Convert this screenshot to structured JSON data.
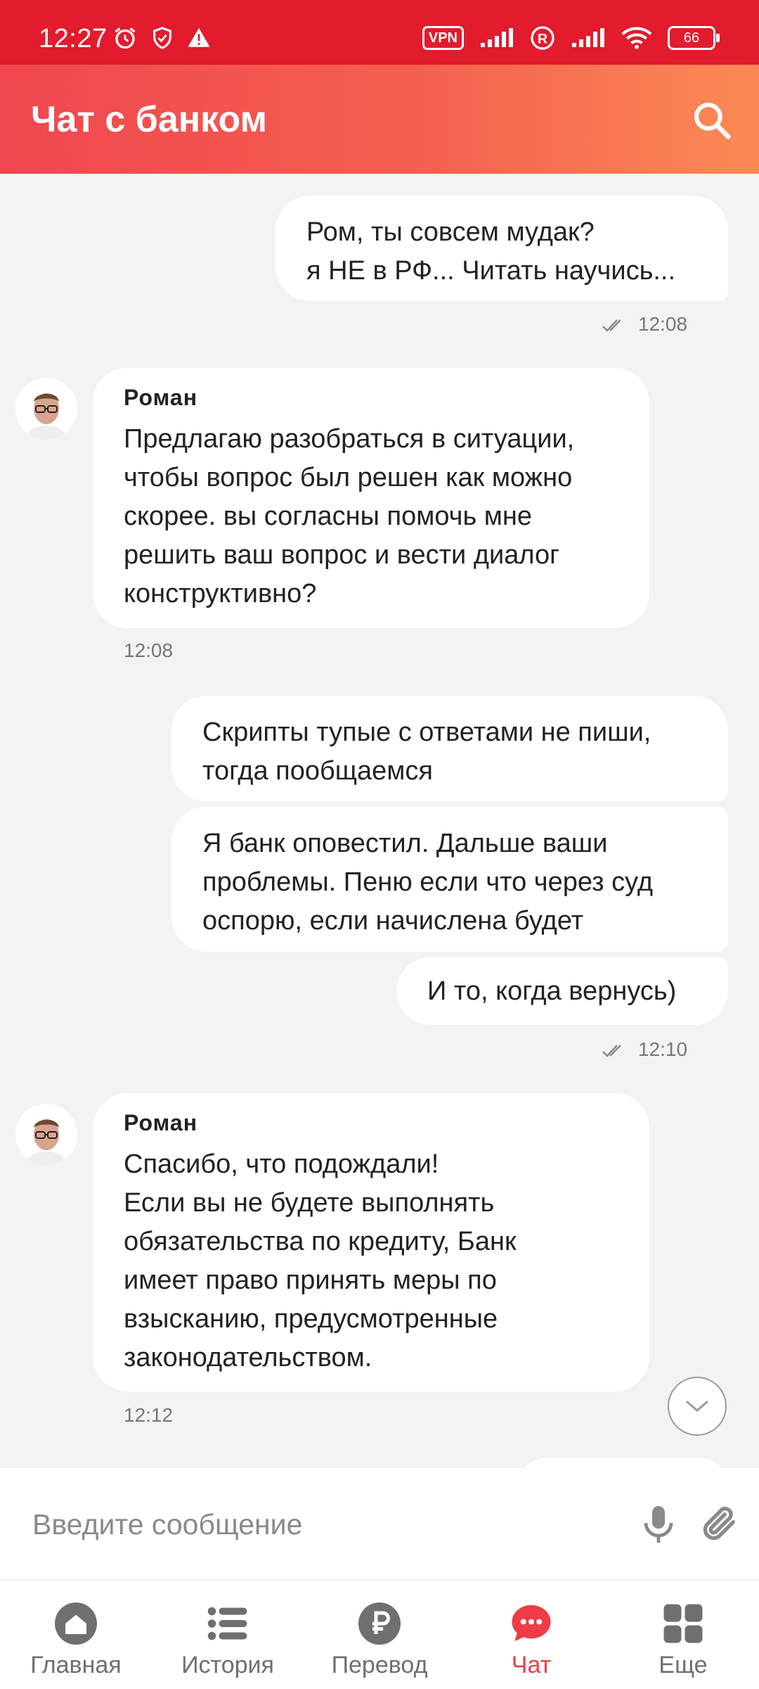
{
  "status_bar": {
    "time": "12:27",
    "vpn": "VPN",
    "battery": "66"
  },
  "header": {
    "title": "Чат с банком"
  },
  "messages": [
    {
      "direction": "out",
      "lines": [
        "Ром, ты совсем мудак?",
        "я НЕ в РФ... Читать научись..."
      ],
      "time": "12:08"
    },
    {
      "direction": "in",
      "sender": "Роман",
      "lines": [
        "Предлагаю разобраться в ситуации,",
        "чтобы вопрос был решен как можно",
        "скорее. вы согласны помочь мне",
        "решить ваш вопрос и вести диалог",
        "конструктивно?"
      ],
      "time": "12:08"
    },
    {
      "direction": "out",
      "lines": [
        "Скрипты тупые с ответами не пиши,",
        "тогда пообщаемся"
      ]
    },
    {
      "direction": "out",
      "lines": [
        "Я банк оповестил. Дальше ваши",
        "проблемы. Пеню если что через суд",
        "оспорю, если начислена будет"
      ]
    },
    {
      "direction": "out",
      "lines": [
        "И то, когда вернусь)"
      ],
      "time": "12:10"
    },
    {
      "direction": "in",
      "sender": "Роман",
      "lines": [
        "Спасибо, что подождали!",
        "Если вы не будете выполнять",
        "обязательства по кредиту, Банк",
        "имеет право принять меры по",
        "взысканию, предусмотренные",
        "законодательством."
      ],
      "time": "12:12"
    }
  ],
  "input": {
    "placeholder": "Введите сообщение"
  },
  "nav": [
    {
      "label": "Главная",
      "icon": "home-icon"
    },
    {
      "label": "История",
      "icon": "list-icon"
    },
    {
      "label": "Перевод",
      "icon": "ruble-icon"
    },
    {
      "label": "Чат",
      "icon": "chat-icon",
      "active": true
    },
    {
      "label": "Еще",
      "icon": "grid-icon"
    }
  ],
  "colors": {
    "accent": "#ee3b45",
    "status_bar": "#e21b2d",
    "header_from": "#f0464f",
    "header_to": "#fb8a55",
    "chat_bg": "#f3f3f3"
  }
}
